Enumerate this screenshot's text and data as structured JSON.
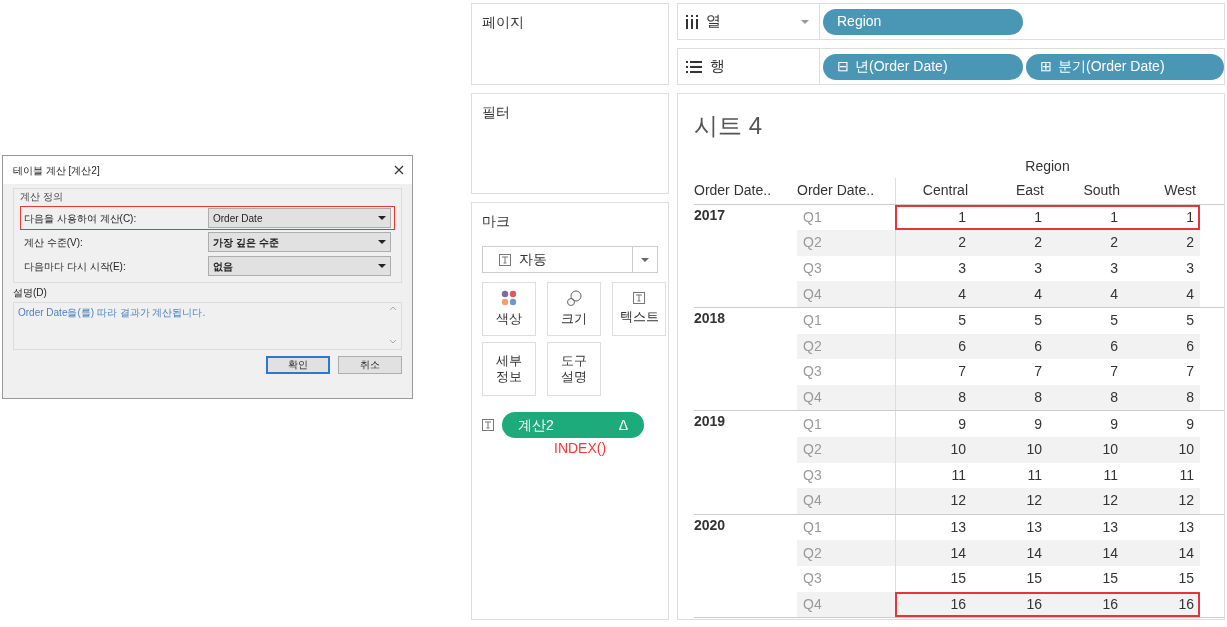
{
  "dialog": {
    "title": "테이블 계산 [계산2]",
    "group_label": "계산 정의",
    "fields": [
      {
        "label": "다음을 사용하여 계산(C):",
        "value": "Order Date",
        "highlighted": true,
        "bold": false
      },
      {
        "label": "계산 수준(V):",
        "value": "가장 깊은 수준",
        "highlighted": false,
        "bold": true
      },
      {
        "label": "다음마다 다시 시작(E):",
        "value": "없음",
        "highlighted": false,
        "bold": true
      }
    ],
    "description_label": "설명(D)",
    "description": "Order Date을(를) 따라 결과가 계산됩니다.",
    "buttons": [
      {
        "label": "확인",
        "default": true
      },
      {
        "label": "취소",
        "default": false
      }
    ]
  },
  "pages_label": "페이지",
  "filters_label": "필터",
  "shelves": [
    {
      "kind": "columns",
      "label": "열",
      "pills": [
        {
          "label": "Region"
        }
      ]
    },
    {
      "kind": "rows",
      "label": "행",
      "pills": [
        {
          "icon": "⊟",
          "label": "년(Order Date)"
        },
        {
          "icon": "⊞",
          "label": "분기(Order Date)"
        }
      ]
    }
  ],
  "marks": {
    "label": "마크",
    "type_value": "자동",
    "cards": [
      {
        "kind": "color",
        "label": "색상"
      },
      {
        "kind": "size",
        "label": "크기"
      },
      {
        "kind": "text",
        "label": "텍스트"
      },
      {
        "kind": "detail",
        "label": "세부\n정보"
      },
      {
        "kind": "tooltip",
        "label": "도구\n설명"
      }
    ],
    "pill": {
      "label": "계산2",
      "suffix": "Δ"
    },
    "formula": "INDEX()"
  },
  "sheet": {
    "title": "시트 4",
    "column_group": "Region",
    "row_headers": [
      "Order Date..",
      "Order Date.."
    ],
    "columns": [
      "Central",
      "East",
      "South",
      "West"
    ],
    "groups": [
      {
        "year": "2017",
        "rows": [
          {
            "quarter": "Q1",
            "values": [
              "1",
              "1",
              "1",
              "1"
            ],
            "highlighted": true
          },
          {
            "quarter": "Q2",
            "values": [
              "2",
              "2",
              "2",
              "2"
            ],
            "highlighted": false
          },
          {
            "quarter": "Q3",
            "values": [
              "3",
              "3",
              "3",
              "3"
            ],
            "highlighted": false
          },
          {
            "quarter": "Q4",
            "values": [
              "4",
              "4",
              "4",
              "4"
            ],
            "highlighted": false
          }
        ]
      },
      {
        "year": "2018",
        "rows": [
          {
            "quarter": "Q1",
            "values": [
              "5",
              "5",
              "5",
              "5"
            ],
            "highlighted": false
          },
          {
            "quarter": "Q2",
            "values": [
              "6",
              "6",
              "6",
              "6"
            ],
            "highlighted": false
          },
          {
            "quarter": "Q3",
            "values": [
              "7",
              "7",
              "7",
              "7"
            ],
            "highlighted": false
          },
          {
            "quarter": "Q4",
            "values": [
              "8",
              "8",
              "8",
              "8"
            ],
            "highlighted": false
          }
        ]
      },
      {
        "year": "2019",
        "rows": [
          {
            "quarter": "Q1",
            "values": [
              "9",
              "9",
              "9",
              "9"
            ],
            "highlighted": false
          },
          {
            "quarter": "Q2",
            "values": [
              "10",
              "10",
              "10",
              "10"
            ],
            "highlighted": false
          },
          {
            "quarter": "Q3",
            "values": [
              "11",
              "11",
              "11",
              "11"
            ],
            "highlighted": false
          },
          {
            "quarter": "Q4",
            "values": [
              "12",
              "12",
              "12",
              "12"
            ],
            "highlighted": false
          }
        ]
      },
      {
        "year": "2020",
        "rows": [
          {
            "quarter": "Q1",
            "values": [
              "13",
              "13",
              "13",
              "13"
            ],
            "highlighted": false
          },
          {
            "quarter": "Q2",
            "values": [
              "14",
              "14",
              "14",
              "14"
            ],
            "highlighted": false
          },
          {
            "quarter": "Q3",
            "values": [
              "15",
              "15",
              "15",
              "15"
            ],
            "highlighted": false
          },
          {
            "quarter": "Q4",
            "values": [
              "16",
              "16",
              "16",
              "16"
            ],
            "highlighted": true
          }
        ]
      }
    ]
  }
}
